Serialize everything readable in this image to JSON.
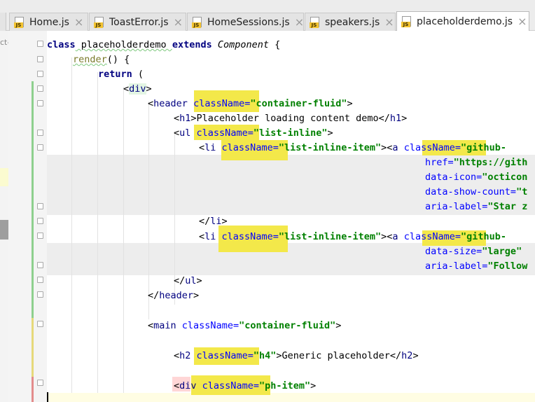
{
  "tabs": [
    {
      "label": "Home.js",
      "active": false
    },
    {
      "label": "ToastError.js",
      "active": false
    },
    {
      "label": "HomeSessions.js",
      "active": false
    },
    {
      "label": "speakers.js",
      "active": false
    },
    {
      "label": "placeholderdemo.js",
      "active": true
    }
  ],
  "file_badge": "JS",
  "close_glyph": "×",
  "strip_fragment": "ct-",
  "colors": {
    "keyword": "#000080",
    "attribute": "#0000ff",
    "string": "#008000",
    "highlight": "#f3e84a",
    "vcs_added": "#8ed08e",
    "vcs_modified": "#e6d97a",
    "vcs_deleted": "#e38c8c"
  },
  "code": {
    "line1": {
      "kw1": "class",
      "name": " placeholderdemo ",
      "kw2": "extends",
      "sp": " ",
      "base": "Component",
      "brace": " {"
    },
    "line2": {
      "fn": "render",
      "rest": "() {"
    },
    "line3": {
      "kw": "return",
      "rest": " ("
    },
    "line4": {
      "open": "<",
      "tag": "div",
      "close": ">"
    },
    "line5": {
      "open": "<",
      "tag": "header",
      "attr": "className",
      "eq": "=",
      "val": "\"container-fluid\"",
      "close": ">"
    },
    "line6": {
      "open": "<",
      "tag": "h1",
      "mid": ">Placeholder loading content demo</",
      "tag2": "h1",
      "close": ">"
    },
    "line7": {
      "open": "<",
      "tag": "ul",
      "attr": "className",
      "eq": "=",
      "val": "\"list-inline\"",
      "close": ">"
    },
    "line8": {
      "open": "<",
      "tag": "li",
      "attr": "className",
      "eq": "=",
      "val": "\"list-inline-item\"",
      "mid": "><",
      "tag2": "a",
      "attr2": "className",
      "eq2": "=",
      "val2": "\"github-"
    },
    "line9": {
      "attr": "href",
      "eq": "=",
      "val": "\"https://gith"
    },
    "line10": {
      "attr": "data-icon",
      "eq": "=",
      "val": "\"octicon"
    },
    "line11": {
      "attr": "data-show-count",
      "eq": "=",
      "val": "\"t"
    },
    "line12": {
      "attr": "aria-label",
      "eq": "=",
      "val": "\"Star z"
    },
    "line13": {
      "open": "</",
      "tag": "li",
      "close": ">"
    },
    "line14": {
      "open": "<",
      "tag": "li",
      "attr": "className",
      "eq": "=",
      "val": "\"list-inline-item\"",
      "mid": "><",
      "tag2": "a",
      "attr2": "className",
      "eq2": "=",
      "val2": "\"github-"
    },
    "line15": {
      "attr": "data-size",
      "eq": "=",
      "val": "\"large\""
    },
    "line16": {
      "attr": "aria-label",
      "eq": "=",
      "val": "\"Follow"
    },
    "line17": {
      "open": "</",
      "tag": "ul",
      "close": ">"
    },
    "line18": {
      "open": "</",
      "tag": "header",
      "close": ">"
    },
    "line20": {
      "open": "<",
      "tag": "main",
      "attr": "className",
      "eq": "=",
      "val": "\"container-fluid\"",
      "close": ">"
    },
    "line22": {
      "open": "<",
      "tag": "h2",
      "attr": "className",
      "eq": "=",
      "val": "\"h4\"",
      "mid": ">Generic placeholder</",
      "tag2": "h2",
      "close": ">"
    },
    "line24": {
      "open": "<",
      "tag": "div",
      "attr": "className",
      "eq": "=",
      "val": "\"ph-item\"",
      "close": ">"
    }
  }
}
